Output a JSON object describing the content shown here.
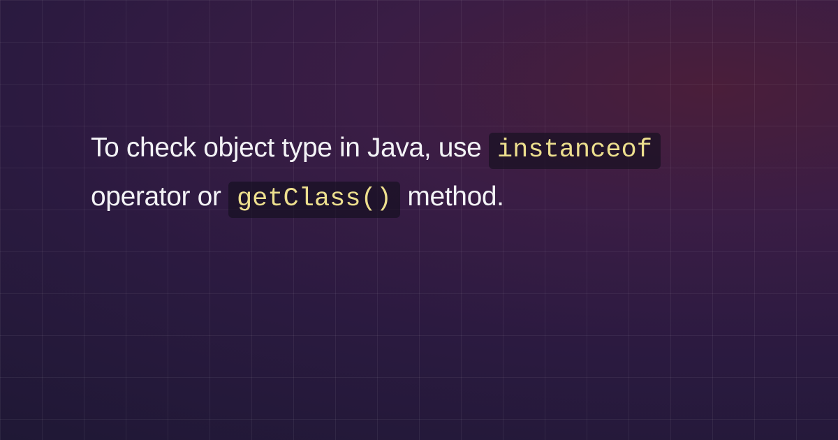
{
  "text": {
    "segment1": "To check object type in Java, use ",
    "code1": "instanceof",
    "segment2": " operator or ",
    "code2": "getClass()",
    "segment3": " method."
  }
}
